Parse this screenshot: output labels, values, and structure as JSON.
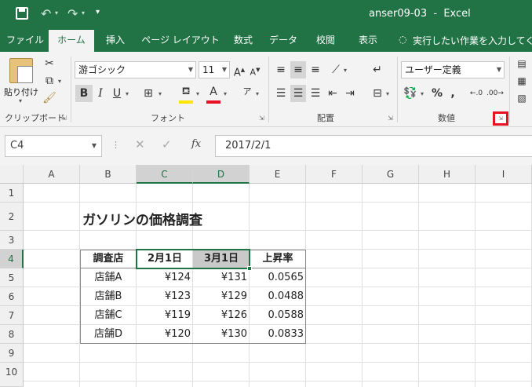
{
  "titlebar": {
    "title": "anser09-03  -  Excel"
  },
  "tabs": [
    "ファイル",
    "ホーム",
    "挿入",
    "ページ レイアウト",
    "数式",
    "データ",
    "校閲",
    "表示"
  ],
  "tell_me": "実行したい作業を入力してくださ",
  "ribbon": {
    "paste_label": "貼り付け",
    "clipboard_label": "クリップボード",
    "font_name": "游ゴシック",
    "font_size": "11",
    "font_label": "フォント",
    "align_label": "配置",
    "number_format": "ユーザー定義",
    "number_label": "数値",
    "font_color": "#e81123",
    "fill_color": "#ffe600",
    "highlight_box_color": "#e81123"
  },
  "formula_bar": {
    "name_box": "C4",
    "fx": "fx",
    "value": "2017/2/1"
  },
  "grid": {
    "columns": [
      "A",
      "B",
      "C",
      "D",
      "E",
      "F",
      "G",
      "H",
      "I"
    ],
    "rows": [
      "1",
      "2",
      "3",
      "4",
      "5",
      "6",
      "7",
      "8",
      "9",
      "10"
    ],
    "title": "ガソリンの価格調査",
    "headers": [
      "調査店",
      "2月1日",
      "3月1日",
      "上昇率"
    ],
    "data": [
      [
        "店舗A",
        "¥124",
        "¥131",
        "0.0565"
      ],
      [
        "店舗B",
        "¥123",
        "¥129",
        "0.0488"
      ],
      [
        "店舗C",
        "¥119",
        "¥126",
        "0.0588"
      ],
      [
        "店舗D",
        "¥120",
        "¥130",
        "0.0833"
      ]
    ]
  }
}
